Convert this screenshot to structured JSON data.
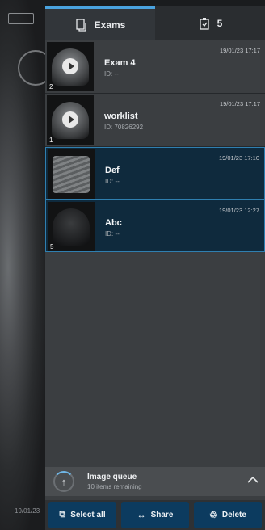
{
  "background": {
    "date_fragment": "19/01/23"
  },
  "tabs": [
    {
      "label": "Exams",
      "icon": "exams-icon"
    },
    {
      "label": "5",
      "icon": "clipboard-icon"
    }
  ],
  "exams": [
    {
      "name": "Exam 4",
      "id": "ID: --",
      "date": "19/01/23 17:17",
      "count": "2",
      "thumb": "play"
    },
    {
      "name": "worklist",
      "id": "ID: 70826292",
      "date": "19/01/23 17:17",
      "count": "1",
      "thumb": "play"
    },
    {
      "name": "Def",
      "id": "ID: --",
      "date": "19/01/23 17:10",
      "count": "",
      "thumb": "gray",
      "selected": true
    },
    {
      "name": "Abc",
      "id": "ID: --",
      "date": "19/01/23 12:27",
      "count": "5",
      "thumb": "dark",
      "selected": true
    }
  ],
  "queue": {
    "title": "Image queue",
    "remaining": "10 items remaining"
  },
  "actions": {
    "select_all": "Select all",
    "share": "Share",
    "delete": "Delete"
  },
  "colors": {
    "accent": "#4aa3df",
    "action_button": "#0c3b5f",
    "selected_row": "#0f2a3d"
  }
}
